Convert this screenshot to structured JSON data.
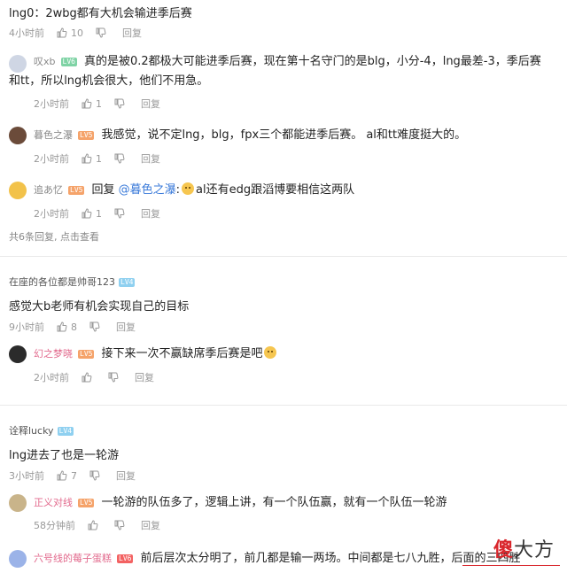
{
  "comments": [
    {
      "user": "lng0：2wbg都有大机会输进季后赛",
      "time": "4小时前",
      "likes": "10",
      "reply_label": "回复",
      "replies": [
        {
          "user": "叹xb",
          "level": "LV6",
          "text": "真的是被0.2都极大可能进季后赛，现在第十名守门的是blg，小分-4，lng最差-3，季后赛",
          "text2": "和tt，所以lng机会很大，他们不用急。",
          "time": "2小时前",
          "likes": "1",
          "reply_label": "回复"
        },
        {
          "user": "暮色之瀑",
          "level": "LV5",
          "text": "我感觉，说不定lng，blg，fpx三个都能进季后赛。 al和tt难度挺大的。",
          "time": "2小时前",
          "likes": "1",
          "reply_label": "回复"
        },
        {
          "user": "追あ忆",
          "level": "LV5",
          "text_prefix": "回复 ",
          "mention": "@暮色之瀑",
          "text": "al还有edg跟滔博要相信这两队",
          "time": "2小时前",
          "likes": "1",
          "reply_label": "回复"
        }
      ],
      "more": "共6条回复, 点击查看"
    },
    {
      "user": "在座的各位都是帅哥123",
      "level": "LV4",
      "content": "感觉大b老师有机会实现自己的目标",
      "time": "9小时前",
      "likes": "8",
      "reply_label": "回复",
      "replies": [
        {
          "user": "幻之梦晓",
          "level": "LV5",
          "text": "接下来一次不赢缺席季后赛是吧",
          "time": "2小时前",
          "likes": "",
          "reply_label": "回复"
        }
      ]
    },
    {
      "user": "诠释lucky",
      "level": "LV4",
      "content": "lng进去了也是一轮游",
      "time": "3小时前",
      "likes": "7",
      "reply_label": "回复",
      "replies": [
        {
          "user": "正义对线",
          "level": "LV5",
          "text": "一轮游的队伍多了，逻辑上讲，有一个队伍赢，就有一个队伍一轮游",
          "time": "58分钟前",
          "likes": "",
          "reply_label": "回复"
        },
        {
          "user": "六号线的莓子蛋糕",
          "level": "LV6",
          "text": "前后层次太分明了，前几都是输一两场。中间都是七八九胜，后面的三四胜",
          "time": "",
          "likes": "",
          "reply_label": ""
        }
      ]
    }
  ],
  "watermark": {
    "brand": "傻",
    "brand2": "大方"
  },
  "colors": {
    "meta": "#999999",
    "mention": "#3a7ad9",
    "level_orange": "#f5a36a"
  }
}
